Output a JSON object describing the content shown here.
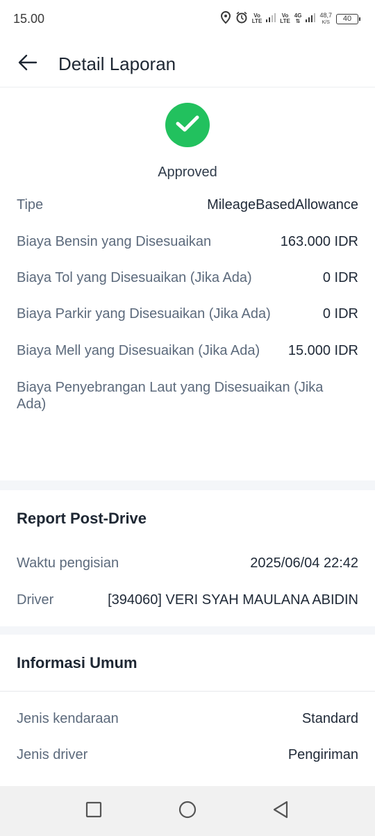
{
  "status_bar": {
    "time": "15.00",
    "net1_top": "Vo",
    "net1_bottom": "LTE",
    "net2_top": "Vo",
    "net2_bottom": "LTE",
    "net3_top": "4G",
    "speed_value": "48,7",
    "speed_unit": "K/S",
    "battery": "40"
  },
  "header": {
    "title": "Detail Laporan"
  },
  "status": {
    "label": "Approved",
    "color": "#22c15e"
  },
  "details": {
    "tipe_label": "Tipe",
    "tipe_value": "MileageBasedAllowance",
    "bensin_label": "Biaya Bensin yang Disesuaikan",
    "bensin_value": "163.000 IDR",
    "tol_label": "Biaya Tol yang Disesuaikan (Jika Ada)",
    "tol_value": "0 IDR",
    "parkir_label": "Biaya Parkir yang Disesuaikan (Jika Ada)",
    "parkir_value": "0 IDR",
    "mell_label": "Biaya Mell yang Disesuaikan (Jika Ada)",
    "mell_value": "15.000 IDR",
    "penyebrangan_label": "Biaya Penyebrangan Laut yang Disesuaikan (Jika Ada)"
  },
  "post_drive": {
    "title": "Report Post-Drive",
    "waktu_label": "Waktu pengisian",
    "waktu_value": "2025/06/04 22:42",
    "driver_label": "Driver",
    "driver_value": "[394060] VERI SYAH MAULANA ABIDIN"
  },
  "informasi_umum": {
    "title": "Informasi Umum",
    "kendaraan_label": "Jenis kendaraan",
    "kendaraan_value": "Standard",
    "driver_label": "Jenis driver",
    "driver_value": "Pengiriman"
  }
}
